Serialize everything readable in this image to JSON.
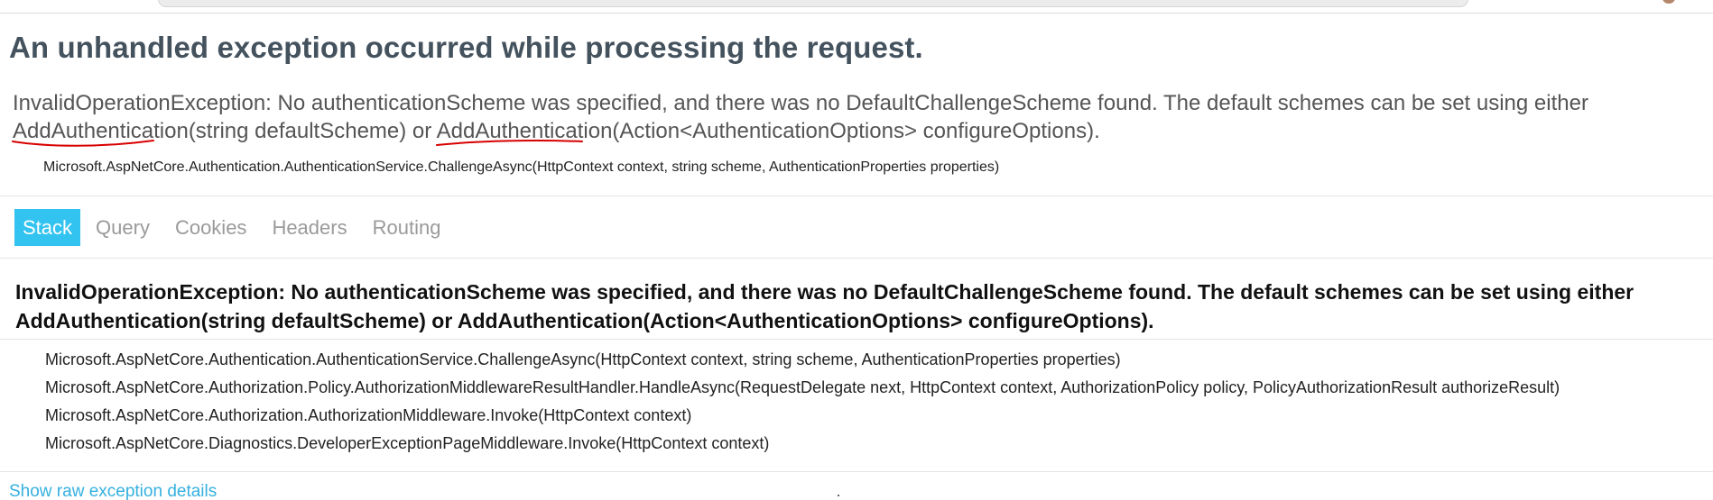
{
  "colors": {
    "title": "#44525e",
    "tab_selected_bg": "#33c3f0",
    "link": "#35b0e0",
    "annotation": "#d80000"
  },
  "page": {
    "title": "An unhandled exception occurred while processing the request."
  },
  "error_summary": {
    "part1": "InvalidOperationException: No authenticationScheme was specified, and there was no DefaultChallengeScheme found. The default schemes can be set using either ",
    "method1": "AddAuthentication",
    "part2": "(string defaultScheme) or ",
    "method2": "AddAuthentication",
    "part3": "(Action<AuthenticationOptions> configureOptions).",
    "location": "Microsoft.AspNetCore.Authentication.AuthenticationService.ChallengeAsync(HttpContext context, string scheme, AuthenticationProperties properties)"
  },
  "tabs": [
    {
      "label": "Stack",
      "selected": true
    },
    {
      "label": "Query",
      "selected": false
    },
    {
      "label": "Cookies",
      "selected": false
    },
    {
      "label": "Headers",
      "selected": false
    },
    {
      "label": "Routing",
      "selected": false
    }
  ],
  "stack": {
    "exception_header": "InvalidOperationException: No authenticationScheme was specified, and there was no DefaultChallengeScheme found. The default schemes can be set using either AddAuthentication(string defaultScheme) or AddAuthentication(Action<AuthenticationOptions> configureOptions).",
    "frames": [
      "Microsoft.AspNetCore.Authentication.AuthenticationService.ChallengeAsync(HttpContext context, string scheme, AuthenticationProperties properties)",
      "Microsoft.AspNetCore.Authorization.Policy.AuthorizationMiddlewareResultHandler.HandleAsync(RequestDelegate next, HttpContext context, AuthorizationPolicy policy, PolicyAuthorizationResult authorizeResult)",
      "Microsoft.AspNetCore.Authorization.AuthorizationMiddleware.Invoke(HttpContext context)",
      "Microsoft.AspNetCore.Diagnostics.DeveloperExceptionPageMiddleware.Invoke(HttpContext context)"
    ],
    "raw_link": "Show raw exception details"
  }
}
